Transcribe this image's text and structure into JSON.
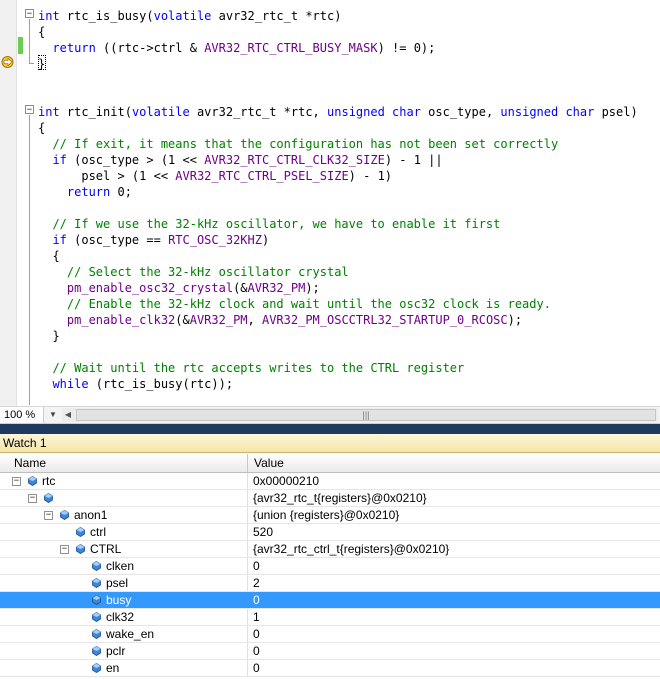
{
  "editor": {
    "lines": [
      {
        "segments": [
          {
            "t": "int ",
            "c": "kw"
          },
          {
            "t": "rtc_is_busy(",
            "c": ""
          },
          {
            "t": "volatile",
            "c": "kw"
          },
          {
            "t": " avr32_rtc_t *rtc)",
            "c": ""
          }
        ]
      },
      {
        "segments": [
          {
            "t": "{",
            "c": ""
          }
        ]
      },
      {
        "segments": [
          {
            "t": "  ",
            "c": ""
          },
          {
            "t": "return",
            "c": "kw"
          },
          {
            "t": " ((rtc->ctrl & ",
            "c": ""
          },
          {
            "t": "AVR32_RTC_CTRL_BUSY_MASK",
            "c": "mac"
          },
          {
            "t": ") != 0);",
            "c": ""
          }
        ]
      },
      {
        "segments": [
          {
            "t": "}",
            "c": ""
          }
        ]
      },
      {
        "segments": []
      },
      {
        "segments": []
      },
      {
        "segments": [
          {
            "t": "int ",
            "c": "kw"
          },
          {
            "t": "rtc_init(",
            "c": ""
          },
          {
            "t": "volatile",
            "c": "kw"
          },
          {
            "t": " avr32_rtc_t *rtc, ",
            "c": ""
          },
          {
            "t": "unsigned char",
            "c": "kw"
          },
          {
            "t": " osc_type, ",
            "c": ""
          },
          {
            "t": "unsigned char",
            "c": "kw"
          },
          {
            "t": " psel)",
            "c": ""
          }
        ]
      },
      {
        "segments": [
          {
            "t": "{",
            "c": ""
          }
        ]
      },
      {
        "segments": [
          {
            "t": "  // If exit, it means that the configuration has not been set correctly",
            "c": "cm"
          }
        ]
      },
      {
        "segments": [
          {
            "t": "  ",
            "c": ""
          },
          {
            "t": "if",
            "c": "kw"
          },
          {
            "t": " (osc_type > (1 << ",
            "c": ""
          },
          {
            "t": "AVR32_RTC_CTRL_CLK32_SIZE",
            "c": "mac"
          },
          {
            "t": ") - 1 ||",
            "c": ""
          }
        ]
      },
      {
        "segments": [
          {
            "t": "      psel > (1 << ",
            "c": ""
          },
          {
            "t": "AVR32_RTC_CTRL_PSEL_SIZE",
            "c": "mac"
          },
          {
            "t": ") - 1)",
            "c": ""
          }
        ]
      },
      {
        "segments": [
          {
            "t": "    ",
            "c": ""
          },
          {
            "t": "return",
            "c": "kw"
          },
          {
            "t": " 0;",
            "c": ""
          }
        ]
      },
      {
        "segments": []
      },
      {
        "segments": [
          {
            "t": "  // If we use the 32-kHz oscillator, we have to enable it first",
            "c": "cm"
          }
        ]
      },
      {
        "segments": [
          {
            "t": "  ",
            "c": ""
          },
          {
            "t": "if",
            "c": "kw"
          },
          {
            "t": " (osc_type == ",
            "c": ""
          },
          {
            "t": "RTC_OSC_32KHZ",
            "c": "mac"
          },
          {
            "t": ")",
            "c": ""
          }
        ]
      },
      {
        "segments": [
          {
            "t": "  {",
            "c": ""
          }
        ]
      },
      {
        "segments": [
          {
            "t": "    // Select the 32-kHz oscillator crystal",
            "c": "cm"
          }
        ]
      },
      {
        "segments": [
          {
            "t": "    ",
            "c": ""
          },
          {
            "t": "pm_enable_osc32_crystal",
            "c": "mac"
          },
          {
            "t": "(&",
            "c": ""
          },
          {
            "t": "AVR32_PM",
            "c": "mac"
          },
          {
            "t": ");",
            "c": ""
          }
        ]
      },
      {
        "segments": [
          {
            "t": "    // Enable the 32-kHz clock and wait until the osc32 clock is ready.",
            "c": "cm"
          }
        ]
      },
      {
        "segments": [
          {
            "t": "    ",
            "c": ""
          },
          {
            "t": "pm_enable_clk32",
            "c": "mac"
          },
          {
            "t": "(&",
            "c": ""
          },
          {
            "t": "AVR32_PM",
            "c": "mac"
          },
          {
            "t": ", ",
            "c": ""
          },
          {
            "t": "AVR32_PM_OSCCTRL32_STARTUP_0_RCOSC",
            "c": "mac"
          },
          {
            "t": ");",
            "c": ""
          }
        ]
      },
      {
        "segments": [
          {
            "t": "  }",
            "c": ""
          }
        ]
      },
      {
        "segments": []
      },
      {
        "segments": [
          {
            "t": "  // Wait until the rtc accepts writes to the CTRL register",
            "c": "cm"
          }
        ]
      },
      {
        "segments": [
          {
            "t": "  ",
            "c": ""
          },
          {
            "t": "while",
            "c": "kw"
          },
          {
            "t": " (rtc_is_busy(rtc));",
            "c": ""
          }
        ]
      }
    ]
  },
  "statusbar": {
    "zoom": "100 %"
  },
  "watch": {
    "title": "Watch 1",
    "col_name": "Name",
    "col_value": "Value",
    "rows": [
      {
        "name": "rtc",
        "value": "0x00000210",
        "depth": 0,
        "expander": "−"
      },
      {
        "name": "",
        "value": "{avr32_rtc_t{registers}@0x0210}",
        "depth": 1,
        "expander": "−"
      },
      {
        "name": "anon1",
        "value": "{union {registers}@0x0210}",
        "depth": 2,
        "expander": "−"
      },
      {
        "name": "ctrl",
        "value": "520",
        "depth": 3,
        "expander": ""
      },
      {
        "name": "CTRL",
        "value": "{avr32_rtc_ctrl_t{registers}@0x0210}",
        "depth": 3,
        "expander": "−"
      },
      {
        "name": "clken",
        "value": "0",
        "depth": 4,
        "expander": ""
      },
      {
        "name": "psel",
        "value": "2",
        "depth": 4,
        "expander": ""
      },
      {
        "name": "busy",
        "value": "0",
        "depth": 4,
        "expander": "",
        "selected": true
      },
      {
        "name": "clk32",
        "value": "1",
        "depth": 4,
        "expander": ""
      },
      {
        "name": "wake_en",
        "value": "0",
        "depth": 4,
        "expander": ""
      },
      {
        "name": "pclr",
        "value": "0",
        "depth": 4,
        "expander": ""
      },
      {
        "name": "en",
        "value": "0",
        "depth": 4,
        "expander": ""
      }
    ]
  },
  "colors": {
    "keyword": "#0000ff",
    "comment": "#008000",
    "macro": "#6f008a",
    "selection": "#3399ff",
    "splitter": "#1f3a5f"
  }
}
